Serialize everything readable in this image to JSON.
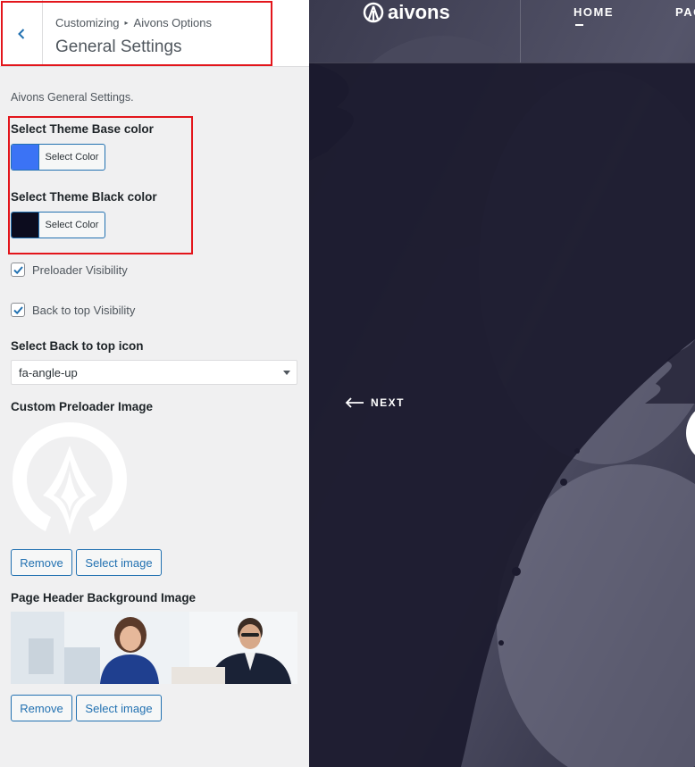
{
  "header": {
    "breadcrumb_root": "Customizing",
    "breadcrumb_section": "Aivons Options",
    "title": "General Settings"
  },
  "description": "Aivons General Settings.",
  "base_color": {
    "label": "Select Theme Base color",
    "button": "Select Color",
    "value": "#3b73f5"
  },
  "black_color": {
    "label": "Select Theme Black color",
    "button": "Select Color",
    "value": "#0c0c1e"
  },
  "preloader_visibility": {
    "label": "Preloader Visibility",
    "checked": true
  },
  "back_to_top_visibility": {
    "label": "Back to top Visibility",
    "checked": true
  },
  "back_to_top_icon": {
    "label": "Select Back to top icon",
    "value": "fa-angle-up"
  },
  "preloader_image": {
    "label": "Custom Preloader Image",
    "remove": "Remove",
    "select": "Select image"
  },
  "header_bg_image": {
    "label": "Page Header Background Image",
    "remove": "Remove",
    "select": "Select image"
  },
  "preview": {
    "logo": "aivons",
    "nav": [
      "HOME",
      "PAG"
    ],
    "next": "NEXT"
  },
  "colors": {
    "accent": "#2271b1",
    "highlight": "#e3151b",
    "preview_bg": "#1b1a2e"
  }
}
